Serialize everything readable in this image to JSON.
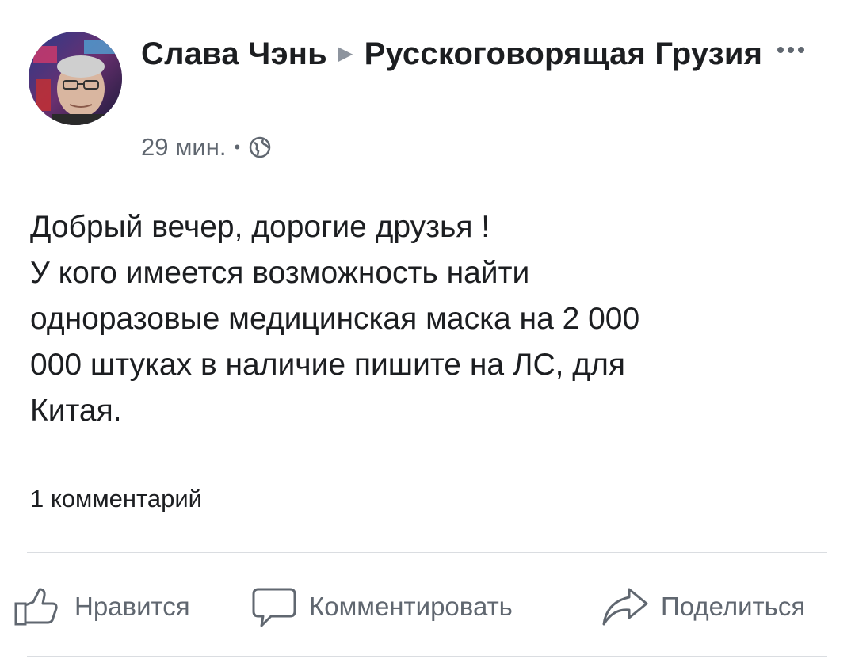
{
  "post": {
    "author": "Слава Чэнь",
    "group": "Русскоговорящая Грузия",
    "time": "29 мин.",
    "separator": "•",
    "text_lines": [
      "Добрый вечер, дорогие друзья !",
      "У кого имеется возможность найти",
      "одноразовые медицинская маска на 2 000",
      "000 штуках в наличие пишите на ЛС, для",
      "Китая."
    ],
    "comments_count": "1 комментарий"
  },
  "actions": {
    "like": "Нравится",
    "comment": "Комментировать",
    "share": "Поделиться"
  },
  "icons": {
    "audience": "globe-icon",
    "more": "more-dots-icon",
    "like": "thumbs-up-icon",
    "comment": "speech-bubble-icon",
    "share": "share-arrow-icon"
  },
  "colors": {
    "text": "#1c1e21",
    "secondary": "#606770",
    "divider": "#dadde1"
  }
}
